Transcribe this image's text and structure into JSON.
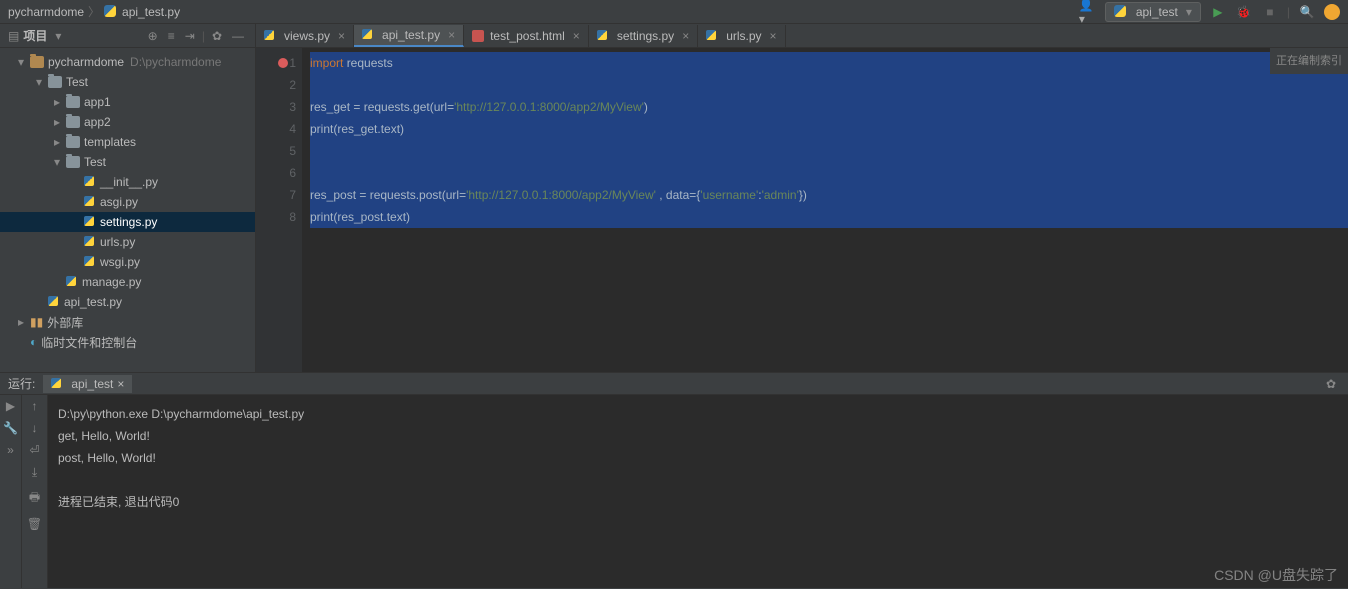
{
  "breadcrumb": {
    "project": "pycharmdome",
    "file": "api_test.py"
  },
  "toolbar": {
    "run_config": "api_test"
  },
  "sidebar": {
    "title": "项目",
    "root": {
      "name": "pycharmdome",
      "path": "D:\\pycharmdome"
    },
    "nodes": [
      {
        "name": "Test"
      },
      {
        "name": "app1"
      },
      {
        "name": "app2"
      },
      {
        "name": "templates"
      },
      {
        "name": "Test"
      },
      {
        "name": "__init__.py"
      },
      {
        "name": "asgi.py"
      },
      {
        "name": "settings.py"
      },
      {
        "name": "urls.py"
      },
      {
        "name": "wsgi.py"
      },
      {
        "name": "manage.py"
      },
      {
        "name": "api_test.py"
      },
      {
        "name": "外部库"
      },
      {
        "name": "临时文件和控制台"
      }
    ]
  },
  "tabs": [
    {
      "label": "views.py"
    },
    {
      "label": "api_test.py"
    },
    {
      "label": "test_post.html"
    },
    {
      "label": "settings.py"
    },
    {
      "label": "urls.py"
    }
  ],
  "code": {
    "lines": [
      {
        "n": "1",
        "seg": [
          {
            "t": "import",
            "c": "kw"
          },
          {
            "t": " ",
            "c": "txt"
          },
          {
            "t": "requests",
            "c": "txt"
          }
        ],
        "sel": true,
        "bp": true
      },
      {
        "n": "2",
        "seg": [],
        "sel": true
      },
      {
        "n": "3",
        "seg": [
          {
            "t": "res_get = requests.get(url=",
            "c": "txt"
          },
          {
            "t": "'http://127.0.0.1:8000/app2/MyView'",
            "c": "str"
          },
          {
            "t": ")",
            "c": "txt"
          }
        ],
        "sel": true
      },
      {
        "n": "4",
        "seg": [
          {
            "t": "print",
            "c": "fn"
          },
          {
            "t": "(res_get.text)",
            "c": "txt"
          }
        ],
        "sel": true
      },
      {
        "n": "5",
        "seg": [],
        "sel": true
      },
      {
        "n": "6",
        "seg": [],
        "sel": true
      },
      {
        "n": "7",
        "seg": [
          {
            "t": "res_post = requests.post(url=",
            "c": "txt"
          },
          {
            "t": "'http://127.0.0.1:8000/app2/MyView'",
            "c": "str"
          },
          {
            "t": " , data={",
            "c": "txt"
          },
          {
            "t": "'username'",
            "c": "str"
          },
          {
            "t": ":",
            "c": "txt"
          },
          {
            "t": "'admin'",
            "c": "str"
          },
          {
            "t": "})",
            "c": "txt"
          }
        ],
        "sel": true
      },
      {
        "n": "8",
        "seg": [
          {
            "t": "print",
            "c": "fn"
          },
          {
            "t": "(res_post.text)",
            "c": "txt"
          }
        ],
        "sel": true
      }
    ],
    "status": "正在编制索引"
  },
  "run": {
    "label": "运行:",
    "tab": "api_test",
    "output": [
      "D:\\py\\python.exe D:\\pycharmdome\\api_test.py",
      "get, Hello, World!",
      "post, Hello, World!",
      "",
      "进程已结束, 退出代码0"
    ]
  },
  "watermark": "CSDN @U盘失踪了"
}
